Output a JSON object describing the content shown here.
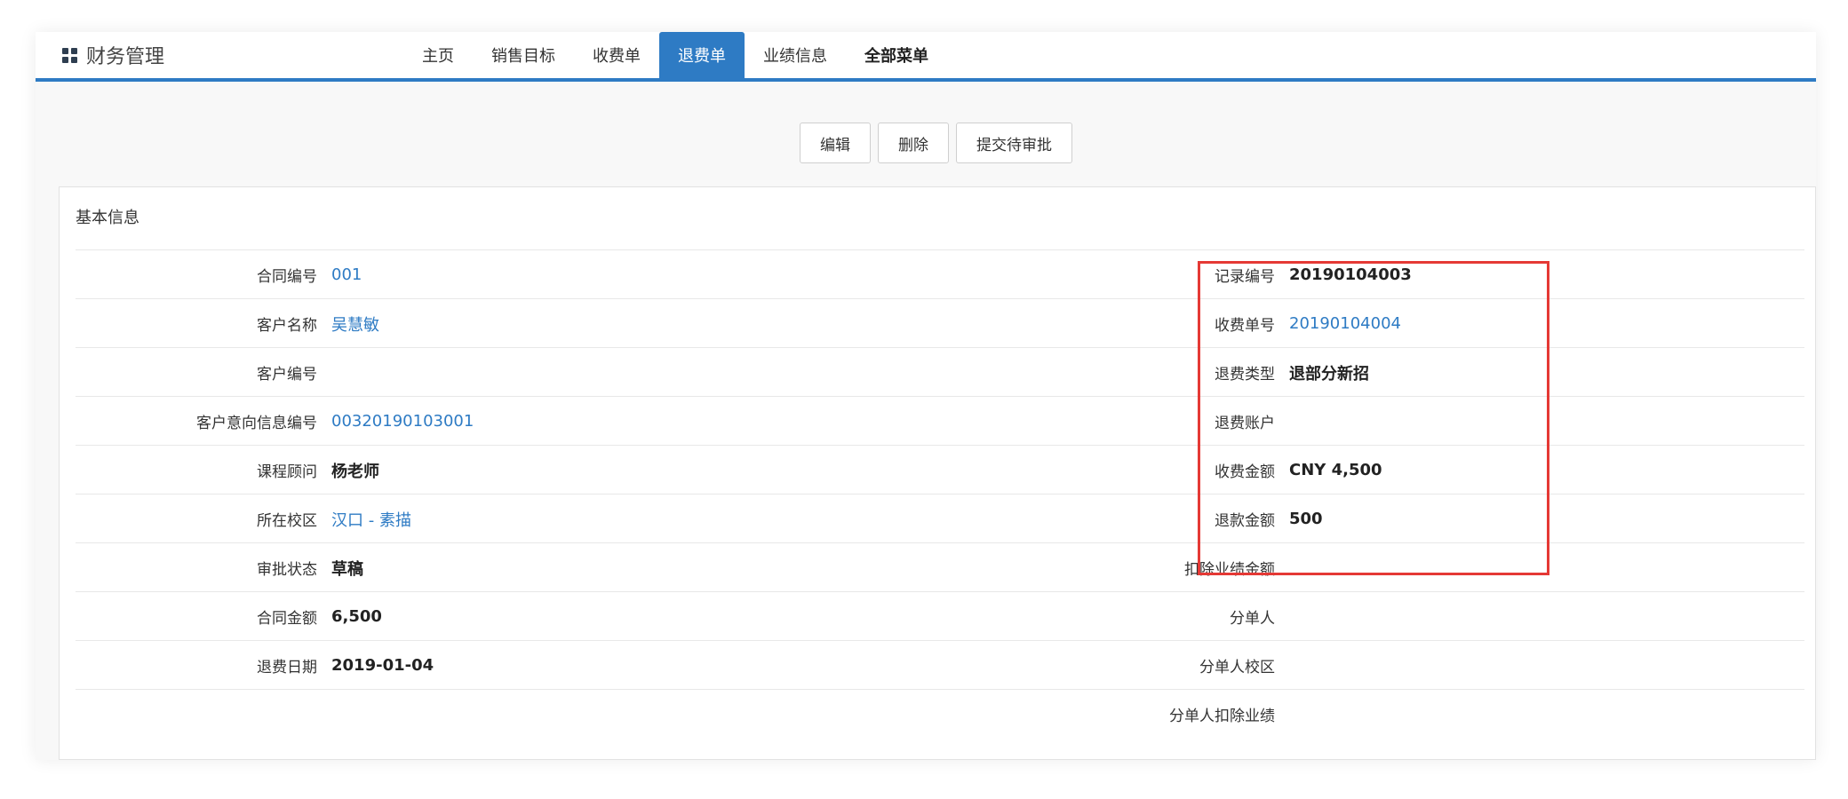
{
  "header": {
    "brand": "财务管理",
    "tabs": [
      {
        "label": "主页"
      },
      {
        "label": "销售目标"
      },
      {
        "label": "收费单"
      },
      {
        "label": "退费单"
      },
      {
        "label": "业绩信息"
      },
      {
        "label": "全部菜单"
      }
    ],
    "active_tab": "退费单",
    "accent_color": "#2e7bc4"
  },
  "toolbar": {
    "edit_label": "编辑",
    "delete_label": "删除",
    "submit_label": "提交待审批"
  },
  "panel": {
    "title": "基本信息",
    "left": [
      {
        "label": "合同编号",
        "value": "001"
      },
      {
        "label": "客户名称",
        "value": "吴慧敏"
      },
      {
        "label": "客户编号",
        "value": ""
      },
      {
        "label": "客户意向信息编号",
        "value": "00320190103001"
      },
      {
        "label": "课程顾问",
        "value": "杨老师"
      },
      {
        "label": "所在校区",
        "value": "汉口 - 素描"
      },
      {
        "label": "审批状态",
        "value": "草稿"
      },
      {
        "label": "合同金额",
        "value": "6,500"
      },
      {
        "label": "退费日期",
        "value": "2019-01-04"
      },
      {
        "label": "",
        "value": ""
      }
    ],
    "right": [
      {
        "label": "记录编号",
        "value": "20190104003"
      },
      {
        "label": "收费单号",
        "value": "20190104004"
      },
      {
        "label": "退费类型",
        "value": "退部分新招"
      },
      {
        "label": "退费账户",
        "value": ""
      },
      {
        "label": "收费金额",
        "value": "CNY 4,500"
      },
      {
        "label": "退款金额",
        "value": "500"
      },
      {
        "label": "扣除业绩金额",
        "value": ""
      },
      {
        "label": "分单人",
        "value": ""
      },
      {
        "label": "分单人校区",
        "value": ""
      },
      {
        "label": "分单人扣除业绩",
        "value": ""
      }
    ]
  },
  "highlight_color": "#e53935"
}
